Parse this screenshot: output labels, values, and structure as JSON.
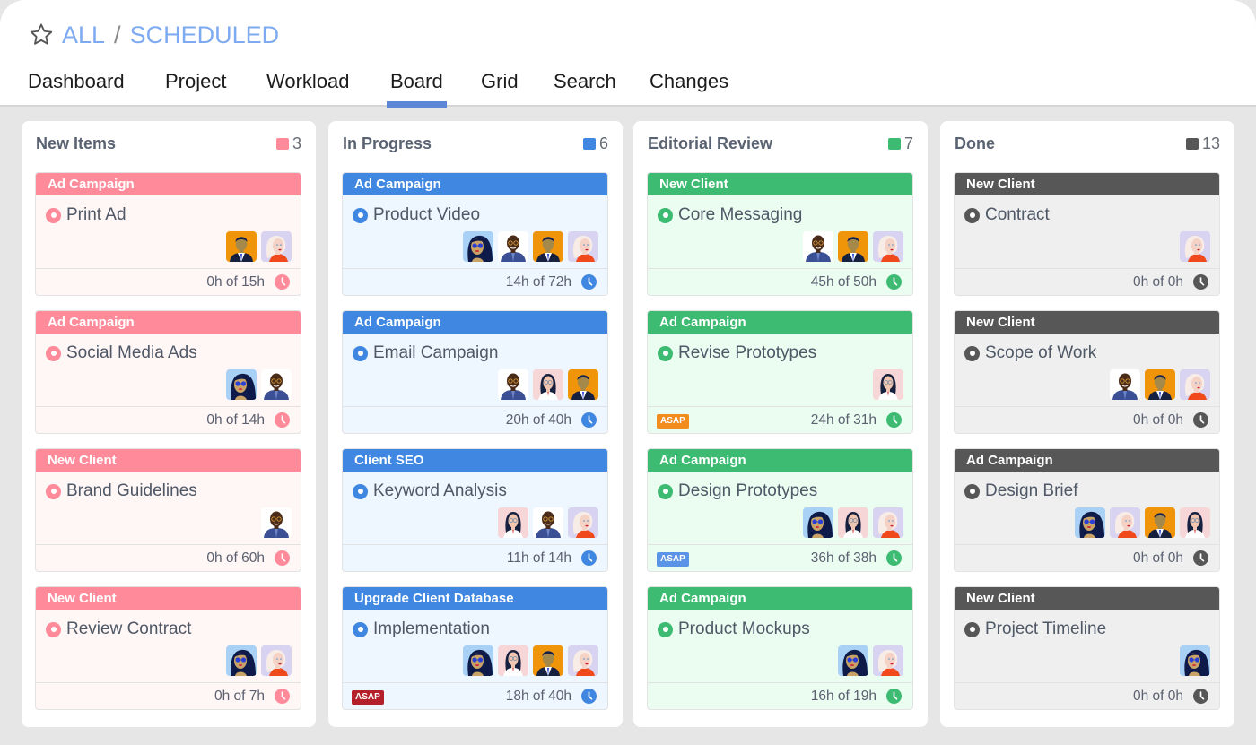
{
  "header": {
    "star_icon": "star-outline-icon",
    "breadcrumb": [
      "ALL",
      "SCHEDULED"
    ],
    "breadcrumb_separator": "/",
    "link_color": "#7eaaf1"
  },
  "tabs": [
    {
      "label": "Dashboard",
      "active": false
    },
    {
      "label": "Project",
      "active": false
    },
    {
      "label": "Workload",
      "active": false
    },
    {
      "label": "Board",
      "active": true
    },
    {
      "label": "Grid",
      "active": false
    },
    {
      "label": "Search",
      "active": false
    },
    {
      "label": "Changes",
      "active": false
    }
  ],
  "avatar_legend": {
    "A": {
      "description": "woman with blue glasses",
      "bg": "#a9d0f5"
    },
    "B": {
      "description": "bald man with glasses",
      "bg": "#ffffff"
    },
    "C": {
      "description": "man in suit",
      "bg": "#f0940a"
    },
    "D": {
      "description": "blonde woman",
      "bg": "#d9d3f2"
    },
    "E": {
      "description": "woman with glasses",
      "bg": "#f6d6d6"
    }
  },
  "columns": [
    {
      "title": "New Items",
      "count": "3",
      "color": "#ff8a9a",
      "card_bg": "#fff6f6",
      "cards": [
        {
          "tag": "Ad Campaign",
          "title": "Print Ad",
          "avatars": [
            "C",
            "D"
          ],
          "hours": "0h of 15h",
          "asap": null
        },
        {
          "tag": "Ad Campaign",
          "title": "Social Media Ads",
          "avatars": [
            "A",
            "B"
          ],
          "hours": "0h of 14h",
          "asap": null
        },
        {
          "tag": "New Client",
          "title": "Brand Guidelines",
          "avatars": [
            "B"
          ],
          "hours": "0h of 60h",
          "asap": null
        },
        {
          "tag": "New Client",
          "title": "Review Contract",
          "avatars": [
            "A",
            "D"
          ],
          "hours": "0h of 7h",
          "asap": null
        }
      ]
    },
    {
      "title": "In Progress",
      "count": "6",
      "color": "#3f87e0",
      "card_bg": "#eef6ff",
      "cards": [
        {
          "tag": "Ad Campaign",
          "title": "Product Video",
          "avatars": [
            "A",
            "B",
            "C",
            "D"
          ],
          "hours": "14h of 72h",
          "asap": null
        },
        {
          "tag": "Ad Campaign",
          "title": "Email Campaign",
          "avatars": [
            "B",
            "E",
            "C"
          ],
          "hours": "20h of 40h",
          "asap": null
        },
        {
          "tag": "Client SEO",
          "title": "Keyword Analysis",
          "avatars": [
            "E",
            "B",
            "D"
          ],
          "hours": "11h of 14h",
          "asap": null
        },
        {
          "tag": "Upgrade Client Database",
          "title": "Implementation",
          "avatars": [
            "A",
            "E",
            "C",
            "D"
          ],
          "hours": "18h of 40h",
          "asap": {
            "label": "ASAP",
            "color": "#b3202a"
          }
        }
      ]
    },
    {
      "title": "Editorial Review",
      "count": "7",
      "color": "#3dbb72",
      "card_bg": "#ebfcf1",
      "cards": [
        {
          "tag": "New Client",
          "title": "Core Messaging",
          "avatars": [
            "B",
            "C",
            "D"
          ],
          "hours": "45h of 50h",
          "asap": null
        },
        {
          "tag": "Ad Campaign",
          "title": "Revise Prototypes",
          "avatars": [
            "E"
          ],
          "hours": "24h of 31h",
          "asap": {
            "label": "ASAP",
            "color": "#f28c1c"
          }
        },
        {
          "tag": "Ad Campaign",
          "title": "Design Prototypes",
          "avatars": [
            "A",
            "E",
            "D"
          ],
          "hours": "36h of 38h",
          "asap": {
            "label": "ASAP",
            "color": "#5b93e6"
          }
        },
        {
          "tag": "Ad Campaign",
          "title": "Product Mockups",
          "avatars": [
            "A",
            "D"
          ],
          "hours": "16h of 19h",
          "asap": null
        }
      ]
    },
    {
      "title": "Done",
      "count": "13",
      "color": "#575757",
      "card_bg": "#efefef",
      "cards": [
        {
          "tag": "New Client",
          "title": "Contract",
          "avatars": [
            "D"
          ],
          "hours": "0h of 0h",
          "asap": null
        },
        {
          "tag": "New Client",
          "title": "Scope of Work",
          "avatars": [
            "B",
            "C",
            "D"
          ],
          "hours": "0h of 0h",
          "asap": null
        },
        {
          "tag": "Ad Campaign",
          "title": "Design Brief",
          "avatars": [
            "A",
            "D",
            "C",
            "E"
          ],
          "hours": "0h of 0h",
          "asap": null
        },
        {
          "tag": "New Client",
          "title": "Project Timeline",
          "avatars": [
            "A"
          ],
          "hours": "0h of 0h",
          "asap": null
        }
      ]
    }
  ]
}
